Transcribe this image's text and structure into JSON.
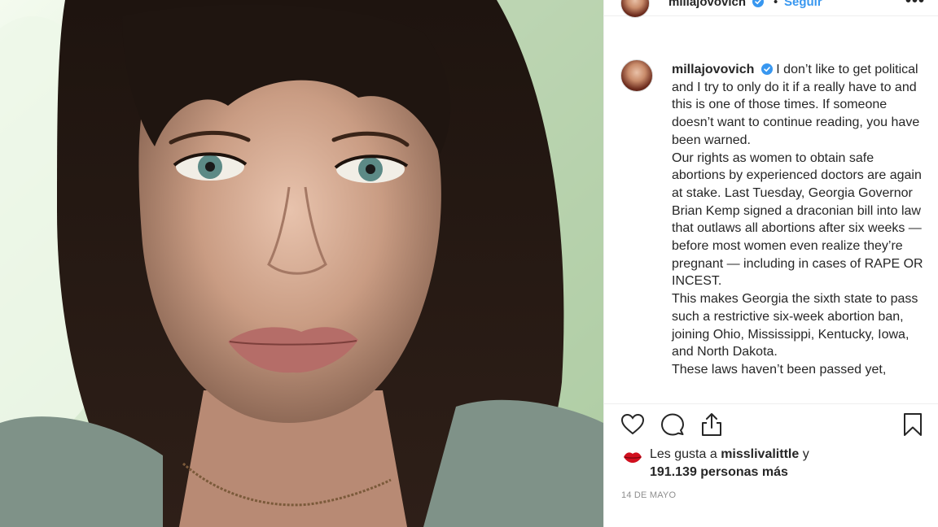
{
  "post": {
    "username": "millajovovich",
    "follow_label": "Seguir",
    "dot": "•",
    "more_label": "•••",
    "photo_icon": "photo",
    "verified_icon": "verified-badge-icon"
  },
  "caption": {
    "username": "millajovovich",
    "paragraphs": [
      "I don’t like to get political and I try to only do it if a really have to and this is one of those times. If someone doesn’t want to continue reading, you have been warned.",
      "Our rights as women to obtain safe abortions by experienced doctors are again at stake. Last Tuesday, Georgia Governor Brian Kemp signed a draconian bill into law that outlaws all abortions after six weeks — before most women even realize they’re pregnant — including in cases of RAPE OR INCEST.",
      "This makes Georgia the sixth state to pass such a restrictive six-week abortion ban, joining Ohio, Mississippi, Kentucky, Iowa, and North Dakota.",
      "These laws haven’t been passed yet,"
    ]
  },
  "actions": {
    "like_icon": "heart-icon",
    "comment_icon": "comment-icon",
    "share_icon": "share-icon",
    "save_icon": "bookmark-icon"
  },
  "likes": {
    "prefix": "Les gusta a",
    "liker": "misslivalittle",
    "conj": "y",
    "count_text": "191.139 personas más"
  },
  "date": "14 DE MAYO",
  "colors": {
    "link_blue": "#3897f0",
    "text": "#262626",
    "muted": "#8e8e8e",
    "border": "#efefef"
  }
}
